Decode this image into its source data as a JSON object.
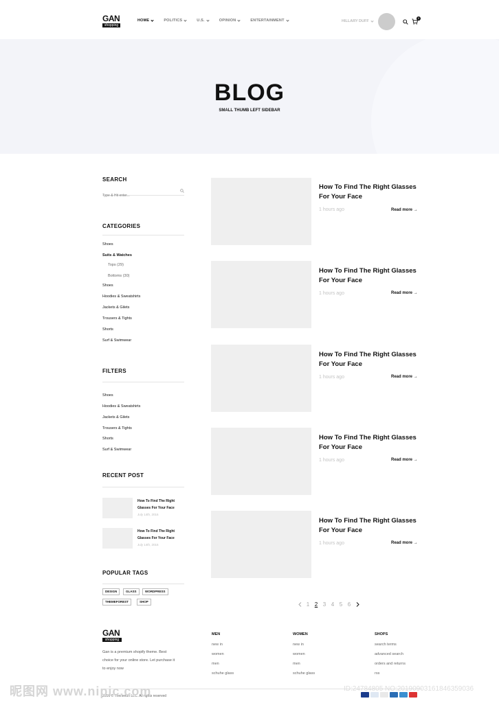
{
  "header": {
    "logo_text": "GAN",
    "logo_sub": "shopping",
    "nav": [
      {
        "label": "HOME",
        "active": true
      },
      {
        "label": "POLITICS",
        "active": false
      },
      {
        "label": "U.S.",
        "active": false
      },
      {
        "label": "OPINION",
        "active": false
      },
      {
        "label": "ENTERTAINMENT",
        "active": false
      }
    ],
    "user_name": "HILLARY DUFF",
    "cart_count": "0"
  },
  "hero": {
    "title": "BLOG",
    "subtitle": "SMALL THUMB LEFT SIDEBAR"
  },
  "sidebar": {
    "search": {
      "heading": "SEARCH",
      "placeholder": "Type & Hit enter..."
    },
    "categories": {
      "heading": "CATEGORIES",
      "items": [
        "Shoes",
        "Suits & Watches",
        "Tops (29)",
        "Bottoms (30)",
        "Shoes",
        "Hoodies & Sweatshirts",
        "Jackets & Gilets",
        "Trousers & Tights",
        "Shorts",
        "Surf & Swimwear"
      ]
    },
    "filters": {
      "heading": "FILTERS",
      "items": [
        "Shoes",
        "Hoodies & Sweatshirts",
        "Jackets & Gilets",
        "Trousers & Tights",
        "Shorts",
        "Surf & Swimwear"
      ]
    },
    "recent": {
      "heading": "RECENT POST",
      "posts": [
        {
          "title": "How To Find The Right Glasses For Your Face",
          "date": "July 14th, 2016"
        },
        {
          "title": "How To Find The Right Glasses For Your Face",
          "date": "July 14th, 2016"
        }
      ]
    },
    "tags": {
      "heading": "POPULAR TAGS",
      "items": [
        "DESIGN",
        "GLASS",
        "WORDPRESS",
        "THEMEFOREST",
        "SHOP"
      ]
    }
  },
  "posts": [
    {
      "title": "How To Find The Right Glasses For Your Face",
      "time": "1 hours ago",
      "more": "Read more"
    },
    {
      "title": "How To Find The Right Glasses For Your Face",
      "time": "1 hours ago",
      "more": "Read more"
    },
    {
      "title": "How To Find The Right Glasses For Your Face",
      "time": "1 hours ago",
      "more": "Read more"
    },
    {
      "title": "How To Find The Right Glasses For Your Face",
      "time": "1 hours ago",
      "more": "Read more"
    },
    {
      "title": "How To Find The Right Glasses For Your Face",
      "time": "1 hours ago",
      "more": "Read more"
    }
  ],
  "pagination": {
    "pages": [
      "1",
      "2",
      "3",
      "4",
      "5",
      "6"
    ],
    "current": "2"
  },
  "footer": {
    "logo_text": "GAN",
    "logo_sub": "shopping",
    "desc": "Gan is a premium shopify theme. Best choice for your online store. Let purchase it to enjoy now",
    "columns": [
      {
        "title": "MEN",
        "links": [
          "new in",
          "women",
          "men",
          "schuhe glass"
        ]
      },
      {
        "title": "WOMEN",
        "links": [
          "new in",
          "women",
          "men",
          "schuhe glass"
        ]
      },
      {
        "title": "SHOPS",
        "links": [
          "search terms",
          "advanced search",
          "orders and returns",
          "rss"
        ]
      }
    ],
    "copyright": "2016 © Themeton LLC. All rights reserved"
  },
  "watermark": {
    "left": "昵图网 www.nipic.com",
    "right": "ID:24784805 NO:20190903161846359036"
  },
  "colors": {
    "hero_bg": "#f3f4f9",
    "thumb_bg": "#efefef",
    "accent": "#111111"
  }
}
